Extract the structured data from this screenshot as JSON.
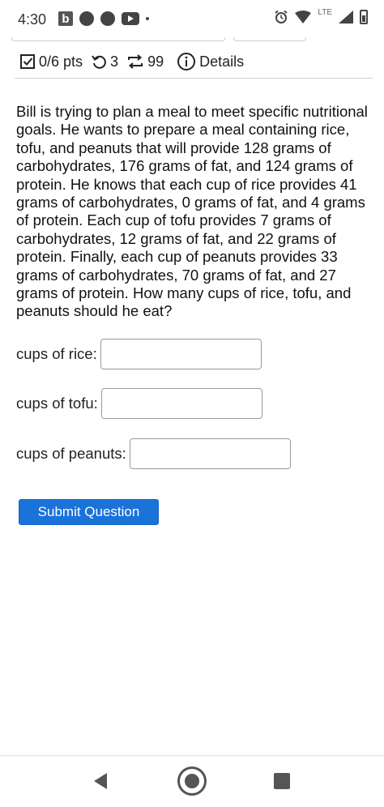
{
  "status_bar": {
    "time": "4:30",
    "b_icon_label": "b",
    "network_label": "LTE"
  },
  "question_header": {
    "score": "0/6 pts",
    "attempts": "3",
    "submissions": "99",
    "details_label": "Details"
  },
  "question": {
    "text": "Bill is trying to plan a meal to meet specific nutritional goals. He wants to prepare a meal containing rice, tofu, and peanuts that will provide 128 grams of carbohydrates, 176 grams of fat, and 124 grams of protein. He knows that each cup of rice provides 41 grams of carbohydrates, 0 grams of fat, and 4 grams of protein.  Each cup of tofu provides  7 grams of carbohydrates, 12 grams of fat, and 22 grams of protein. Finally, each cup of peanuts provides  33 grams of carbohydrates, 70 grams of fat, and 27 grams of protein.  How many cups of rice, tofu, and peanuts should he eat?"
  },
  "answers": {
    "rice": {
      "label": "cups of rice:",
      "value": ""
    },
    "tofu": {
      "label": "cups of tofu:",
      "value": ""
    },
    "peanuts": {
      "label": "cups of peanuts:",
      "value": ""
    }
  },
  "submit": {
    "label": "Submit Question",
    "color": "#1a73d9"
  }
}
